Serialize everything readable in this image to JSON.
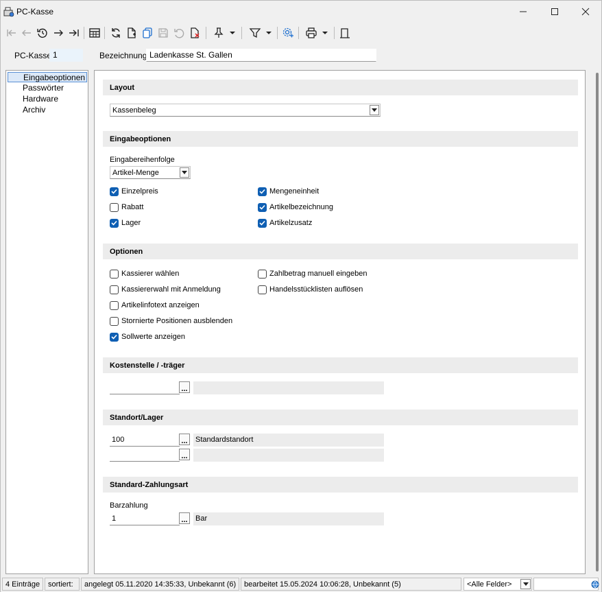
{
  "window": {
    "title": "PC-Kasse"
  },
  "toolbar": {
    "buttons": [
      "first-record",
      "previous-record",
      "history",
      "next-record",
      "last-record",
      "table-view",
      "refresh",
      "new-record",
      "copy-record",
      "save-record",
      "undo",
      "delete-record",
      "pin",
      "pin-menu",
      "filter",
      "filter-menu",
      "settings",
      "print",
      "print-menu",
      "exit"
    ]
  },
  "header": {
    "pc_kasse_label": "PC-Kasse",
    "pc_kasse_value": "1",
    "bezeichnung_label": "Bezeichnung",
    "bezeichnung_value": "Ladenkasse St. Gallen"
  },
  "tree": {
    "items": [
      {
        "label": "Eingabeoptionen",
        "selected": true
      },
      {
        "label": "Passwörter"
      },
      {
        "label": "Hardware"
      },
      {
        "label": "Archiv"
      }
    ]
  },
  "layout_section": {
    "title": "Layout",
    "select_value": "Kassenbeleg"
  },
  "eingabe_section": {
    "title": "Eingabeoptionen",
    "reihenfolge_label": "Eingabereihenfolge",
    "reihenfolge_value": "Artikel-Menge",
    "checkboxes": [
      {
        "label": "Einzelpreis",
        "checked": true
      },
      {
        "label": "Rabatt",
        "checked": false
      },
      {
        "label": "Lager",
        "checked": true
      },
      {
        "label": "Mengeneinheit",
        "checked": true
      },
      {
        "label": "Artikelbezeichnung",
        "checked": true
      },
      {
        "label": "Artikelzusatz",
        "checked": true
      }
    ]
  },
  "optionen_section": {
    "title": "Optionen",
    "checkboxes": [
      {
        "label": "Kassierer wählen",
        "checked": false
      },
      {
        "label": "Kassiererwahl mit Anmeldung",
        "checked": false
      },
      {
        "label": "Artikelinfotext anzeigen",
        "checked": false
      },
      {
        "label": "Stornierte Positionen ausblenden",
        "checked": false
      },
      {
        "label": "Sollwerte anzeigen",
        "checked": true
      },
      {
        "label": "Zahlbetrag manuell eingeben",
        "checked": false
      },
      {
        "label": "Handelsstücklisten auflösen",
        "checked": false
      }
    ]
  },
  "kosten_section": {
    "title": "Kostenstelle / -träger",
    "value": "",
    "description": "",
    "dots": "..."
  },
  "standort_section": {
    "title": "Standort/Lager",
    "standort_value": "100",
    "standort_description": "Standardstandort",
    "lager_value": "",
    "lager_description": "",
    "dots": "..."
  },
  "zahlungsart_section": {
    "title": "Standard-Zahlungsart",
    "barzahlung_label": "Barzahlung",
    "barzahlung_value": "1",
    "barzahlung_description": "Bar",
    "dots": "..."
  },
  "status": {
    "entries": "4 Einträge",
    "sorted": "sortiert:",
    "created": "angelegt 05.11.2020 14:35:33, Unbekannt (6)",
    "edited": "bearbeitet 15.05.2024 10:06:28, Unbekannt (5)",
    "field_select": "<Alle Felder>",
    "search_value": ""
  },
  "colors": {
    "accent": "#0f5fb3",
    "selection": "#dce9f8",
    "section_bg": "#ececec"
  }
}
